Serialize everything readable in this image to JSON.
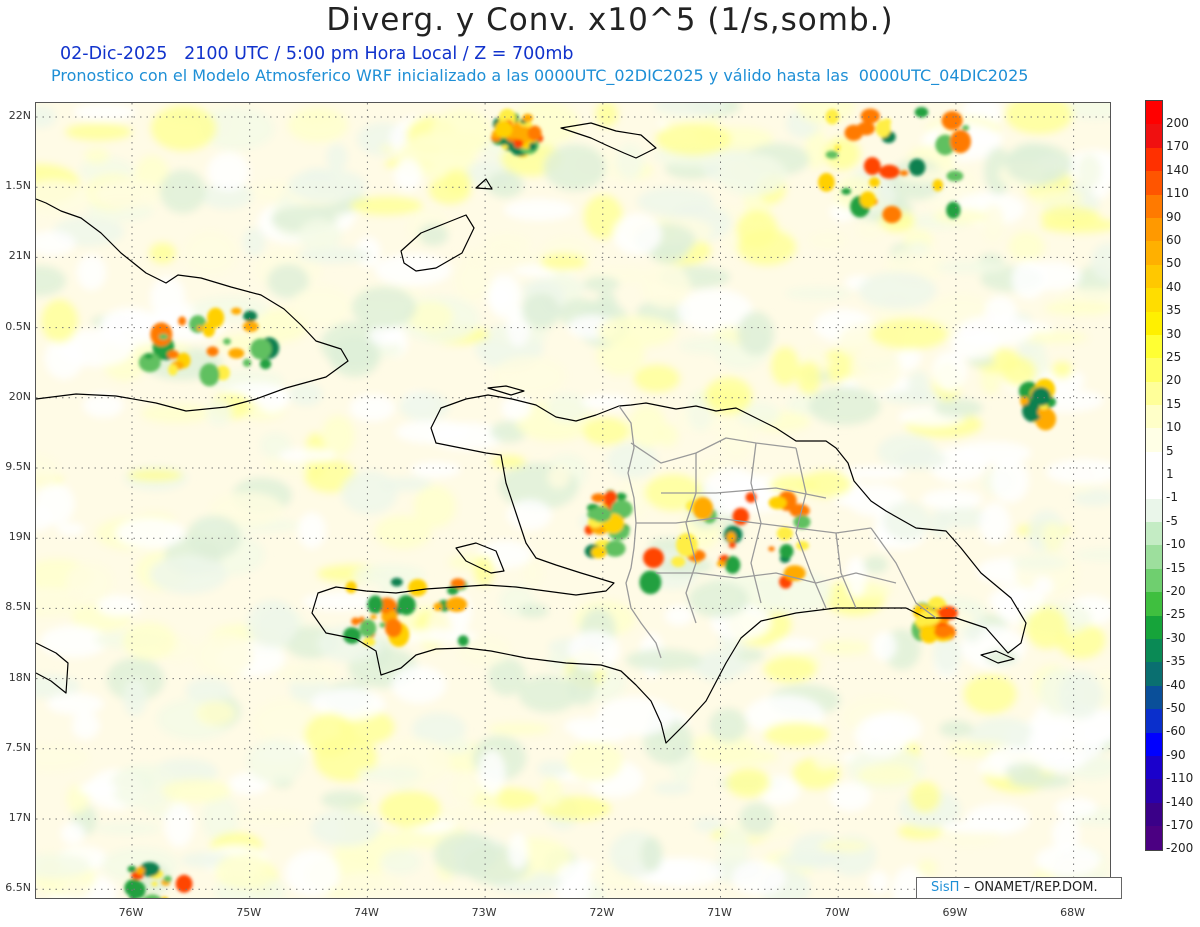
{
  "title": "Diverg. y Conv. x10^5 (1/s,somb.)",
  "subtitle_time": "02-Dic-2025   2100 UTC / 5:00 pm Hora Local / Z = 700mb",
  "subtitle_model": "Pronostico con el Modelo Atmosferico WRF inicializado a las 0000UTC_02DIC2025 y válido hasta las  0000UTC_04DIC2025",
  "lat_ticks": [
    "22N",
    "1.5N",
    "21N",
    "0.5N",
    "20N",
    "9.5N",
    "19N",
    "8.5N",
    "18N",
    "7.5N",
    "17N",
    "6.5N"
  ],
  "lon_ticks": [
    "76W",
    "75W",
    "74W",
    "73W",
    "72W",
    "71W",
    "70W",
    "69W",
    "68W"
  ],
  "colorbar": {
    "labels": [
      "200",
      "170",
      "140",
      "110",
      "90",
      "60",
      "50",
      "40",
      "35",
      "30",
      "25",
      "20",
      "15",
      "10",
      "5",
      "1",
      "-1",
      "-5",
      "-10",
      "-15",
      "-20",
      "-25",
      "-30",
      "-35",
      "-40",
      "-50",
      "-60",
      "-90",
      "-110",
      "-140",
      "-170",
      "-200"
    ],
    "colors": [
      "#ff0000",
      "#f01010",
      "#ff3000",
      "#ff5500",
      "#ff7a00",
      "#ff9900",
      "#ffb000",
      "#ffc800",
      "#ffdd00",
      "#fff000",
      "#ffff33",
      "#ffff66",
      "#ffff99",
      "#ffffc8",
      "#ffffe6",
      "#ffffff",
      "#ffffff",
      "#eaf6ea",
      "#c4ecc4",
      "#9ddf9d",
      "#6fcf6f",
      "#3fbf3f",
      "#16a43a",
      "#0a8a55",
      "#0a6f70",
      "#0a4f99",
      "#0a2fcc",
      "#0000ff",
      "#1a00cc",
      "#2a00aa",
      "#3a0088",
      "#4b0082"
    ]
  },
  "credit": {
    "brand": "SisΠ",
    "rest": "– ONAMET/REP.DOM."
  }
}
